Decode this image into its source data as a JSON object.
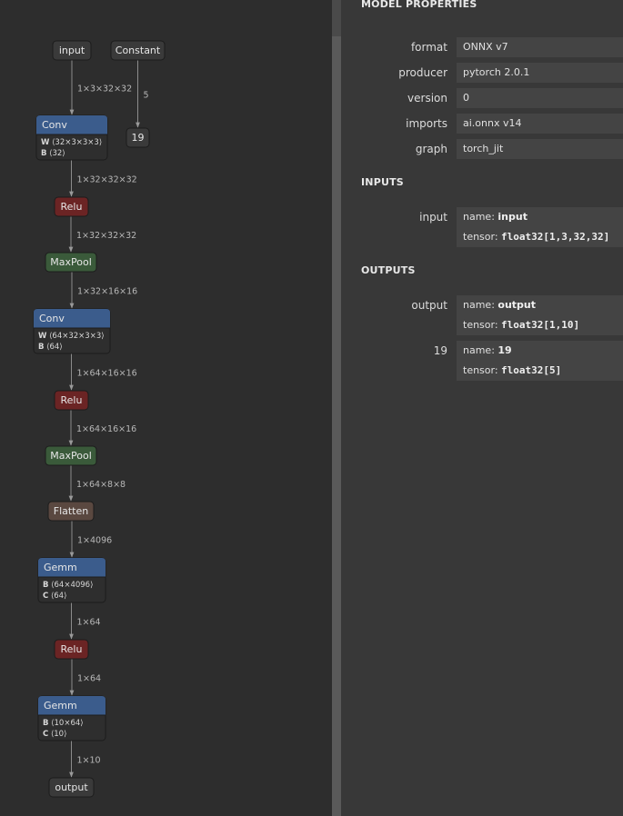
{
  "graph": {
    "nodes": [
      {
        "label": "input",
        "kind": "io"
      },
      {
        "label": "Constant",
        "kind": "io"
      },
      {
        "label": "19",
        "kind": "io"
      },
      {
        "label": "Conv",
        "kind": "layer",
        "attrs": [
          [
            "W",
            "⟨32×3×3×3⟩"
          ],
          [
            "B",
            "⟨32⟩"
          ]
        ]
      },
      {
        "label": "Relu",
        "kind": "activation"
      },
      {
        "label": "MaxPool",
        "kind": "pool"
      },
      {
        "label": "Conv",
        "kind": "layer",
        "attrs": [
          [
            "W",
            "⟨64×32×3×3⟩"
          ],
          [
            "B",
            "⟨64⟩"
          ]
        ]
      },
      {
        "label": "Relu",
        "kind": "activation"
      },
      {
        "label": "MaxPool",
        "kind": "pool"
      },
      {
        "label": "Flatten",
        "kind": "shape"
      },
      {
        "label": "Gemm",
        "kind": "layer",
        "attrs": [
          [
            "B",
            "⟨64×4096⟩"
          ],
          [
            "C",
            "⟨64⟩"
          ]
        ]
      },
      {
        "label": "Relu",
        "kind": "activation"
      },
      {
        "label": "Gemm",
        "kind": "layer",
        "attrs": [
          [
            "B",
            "⟨10×64⟩"
          ],
          [
            "C",
            "⟨10⟩"
          ]
        ]
      },
      {
        "label": "output",
        "kind": "io"
      }
    ],
    "edges": [
      {
        "from": 0,
        "to": 3,
        "label": "1×3×32×32"
      },
      {
        "from": 1,
        "to": 2,
        "label": "5"
      },
      {
        "from": 3,
        "to": 4,
        "label": "1×32×32×32"
      },
      {
        "from": 4,
        "to": 5,
        "label": "1×32×32×32"
      },
      {
        "from": 5,
        "to": 6,
        "label": "1×32×16×16"
      },
      {
        "from": 6,
        "to": 7,
        "label": "1×64×16×16"
      },
      {
        "from": 7,
        "to": 8,
        "label": "1×64×16×16"
      },
      {
        "from": 8,
        "to": 9,
        "label": "1×64×8×8"
      },
      {
        "from": 9,
        "to": 10,
        "label": "1×4096"
      },
      {
        "from": 10,
        "to": 11,
        "label": "1×64"
      },
      {
        "from": 11,
        "to": 12,
        "label": "1×64"
      },
      {
        "from": 12,
        "to": 13,
        "label": "1×10"
      }
    ]
  },
  "colors": {
    "layer": "#3b5c8c",
    "activation": "#6b2424",
    "pool": "#3a5a3a",
    "shape": "#5a4840",
    "io": "#3a3a3a",
    "body": "#2e2e2e"
  },
  "panel": {
    "model_title": "MODEL PROPERTIES",
    "model_rows": [
      {
        "label": "format",
        "value": "ONNX v7"
      },
      {
        "label": "producer",
        "value": "pytorch 2.0.1"
      },
      {
        "label": "version",
        "value": "0"
      },
      {
        "label": "imports",
        "value": "ai.onnx v14"
      },
      {
        "label": "graph",
        "value": "torch_jit"
      }
    ],
    "inputs_title": "INPUTS",
    "inputs": [
      {
        "label": "input",
        "name_prefix": "name: ",
        "name": "input",
        "tensor_prefix": "tensor: ",
        "tensor": "float32[1,3,32,32]"
      }
    ],
    "outputs_title": "OUTPUTS",
    "outputs": [
      {
        "label": "output",
        "name_prefix": "name: ",
        "name": "output",
        "tensor_prefix": "tensor: ",
        "tensor": "float32[1,10]"
      },
      {
        "label": "19",
        "name_prefix": "name: ",
        "name": "19",
        "tensor_prefix": "tensor: ",
        "tensor": "float32[5]"
      }
    ]
  }
}
